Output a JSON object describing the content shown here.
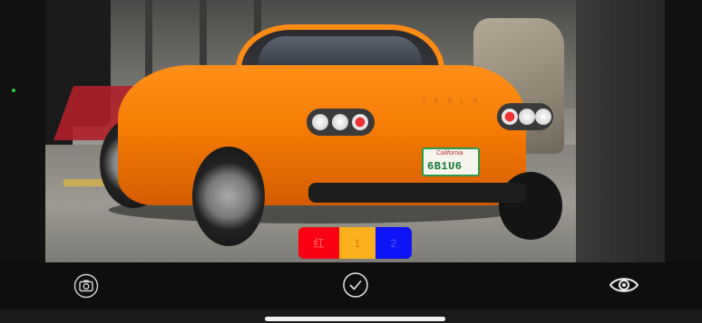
{
  "color_selector": {
    "red_label": "红",
    "amber_label": "1",
    "blue_label": "2",
    "red_color": "#f90012",
    "amber_color": "#fbb01f",
    "blue_color": "#0d15f8"
  },
  "viewfinder": {
    "plate_text": "6B1U6",
    "plate_state": "California",
    "car_wordmark": "TESLA"
  },
  "toolbar": {
    "left_icon": "camera-switch-icon",
    "center_icon": "checkmark-circle-icon",
    "right_icon": "eye-icon"
  },
  "status": {
    "indicator_color": "#2ad13a"
  }
}
